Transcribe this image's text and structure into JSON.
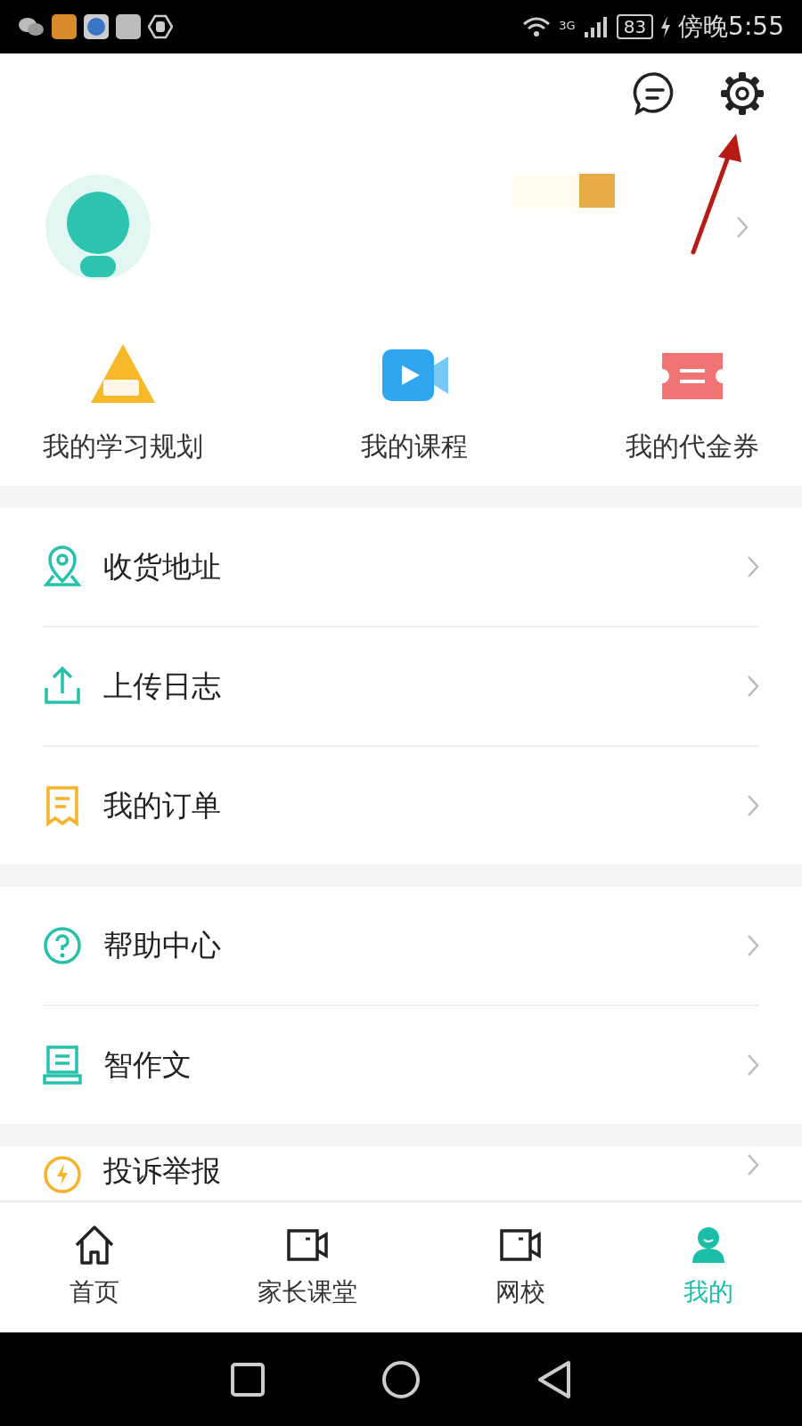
{
  "status_bar": {
    "network": "3G",
    "battery": "83",
    "time": "傍晚5:55"
  },
  "quick_actions": [
    {
      "kind": "plan",
      "label": "我的学习规划"
    },
    {
      "kind": "course",
      "label": "我的课程"
    },
    {
      "kind": "voucher",
      "label": "我的代金券"
    }
  ],
  "menu_groups": [
    [
      {
        "kind": "location",
        "label": "收货地址"
      },
      {
        "kind": "upload",
        "label": "上传日志"
      },
      {
        "kind": "order",
        "label": "我的订单"
      }
    ],
    [
      {
        "kind": "help",
        "label": "帮助中心"
      },
      {
        "kind": "compose",
        "label": "智作文"
      }
    ],
    [
      {
        "kind": "complaint",
        "label": "投诉举报"
      }
    ]
  ],
  "tabs": [
    {
      "kind": "home",
      "label": "首页",
      "selected": false
    },
    {
      "kind": "video",
      "label": "家长课堂",
      "selected": false
    },
    {
      "kind": "video",
      "label": "网校",
      "selected": false
    },
    {
      "kind": "person",
      "label": "我的",
      "selected": true
    }
  ]
}
